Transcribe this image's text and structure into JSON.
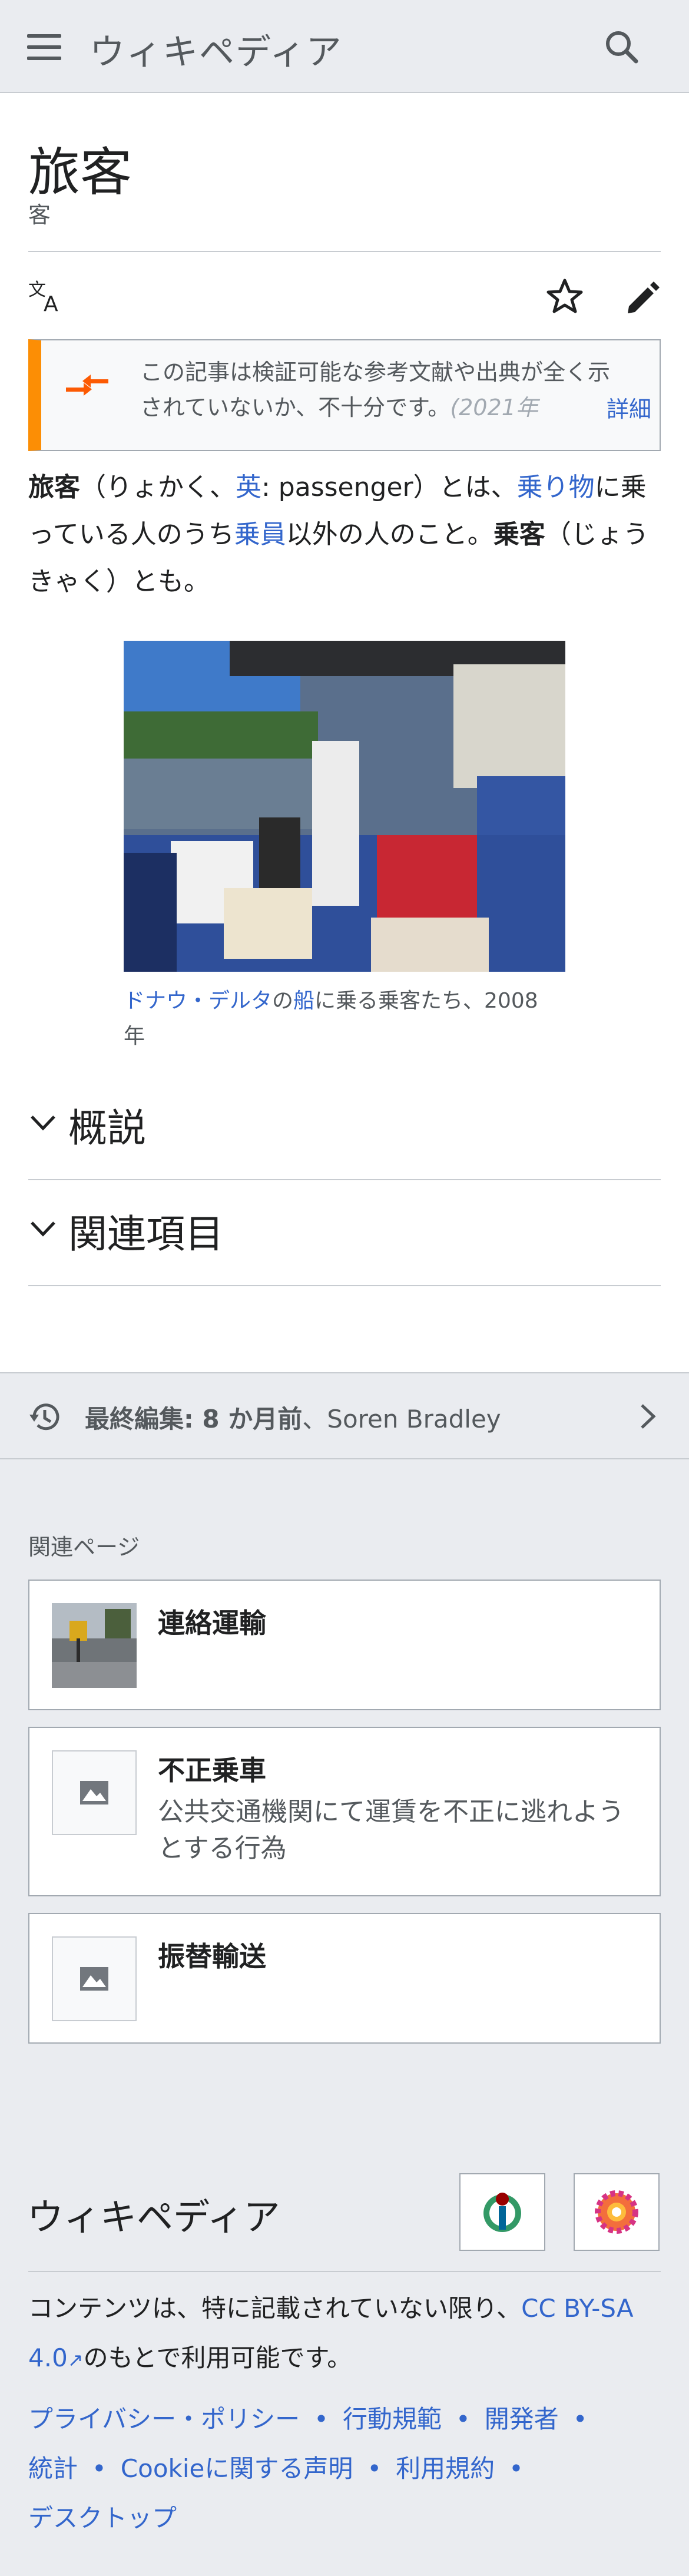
{
  "header": {
    "wordmark": "ウィキペディア"
  },
  "article": {
    "title": "旅客",
    "subtitle": "客",
    "notice": {
      "text": "この記事は検証可能な参考文献や出典が全く示されていないか、不十分です。",
      "date": "(2021年",
      "more": "詳細"
    },
    "lead": {
      "term1": "旅客",
      "p1": "（りょかく、",
      "lang_link": "英",
      "p2": ": passenger）とは、",
      "vehicle_link": "乗り物",
      "p3": "に乗っている人のうち",
      "crew_link": "乗員",
      "p4": "以外の人のこと。",
      "term2": "乗客",
      "p5": "（じょうきゃく）とも。"
    },
    "figure": {
      "caption_link1": "ドナウ・デルタ",
      "caption_p1": "の",
      "caption_link2": "船",
      "caption_p2": "に乗る乗客たち、2008年"
    },
    "sections": [
      "概説",
      "関連項目"
    ]
  },
  "last_edited": {
    "label": "最終編集: 8 か月前",
    "sep": "、",
    "user": "Soren Bradley"
  },
  "related": {
    "heading": "関連ページ",
    "items": [
      {
        "title": "連絡運輸",
        "description": ""
      },
      {
        "title": "不正乗車",
        "description": "公共交通機関にて運賃を不正に逃れようとする行為"
      },
      {
        "title": "振替輸送",
        "description": ""
      }
    ]
  },
  "footer": {
    "wordmark": "ウィキペディア",
    "license_p1": "コンテンツは、特に記載されていない限り、",
    "license_link": "CC BY-SA 4.0",
    "license_p2": "のもとで利用可能です。",
    "links": [
      "プライバシー・ポリシー",
      "行動規範",
      "開発者",
      "統計",
      "Cookieに関する声明",
      "利用規約",
      "デスクトップ"
    ]
  },
  "colors": {
    "link": "#3366cc",
    "notice_accent": "#fc8e05",
    "chrome_bg": "#eaecf0"
  }
}
